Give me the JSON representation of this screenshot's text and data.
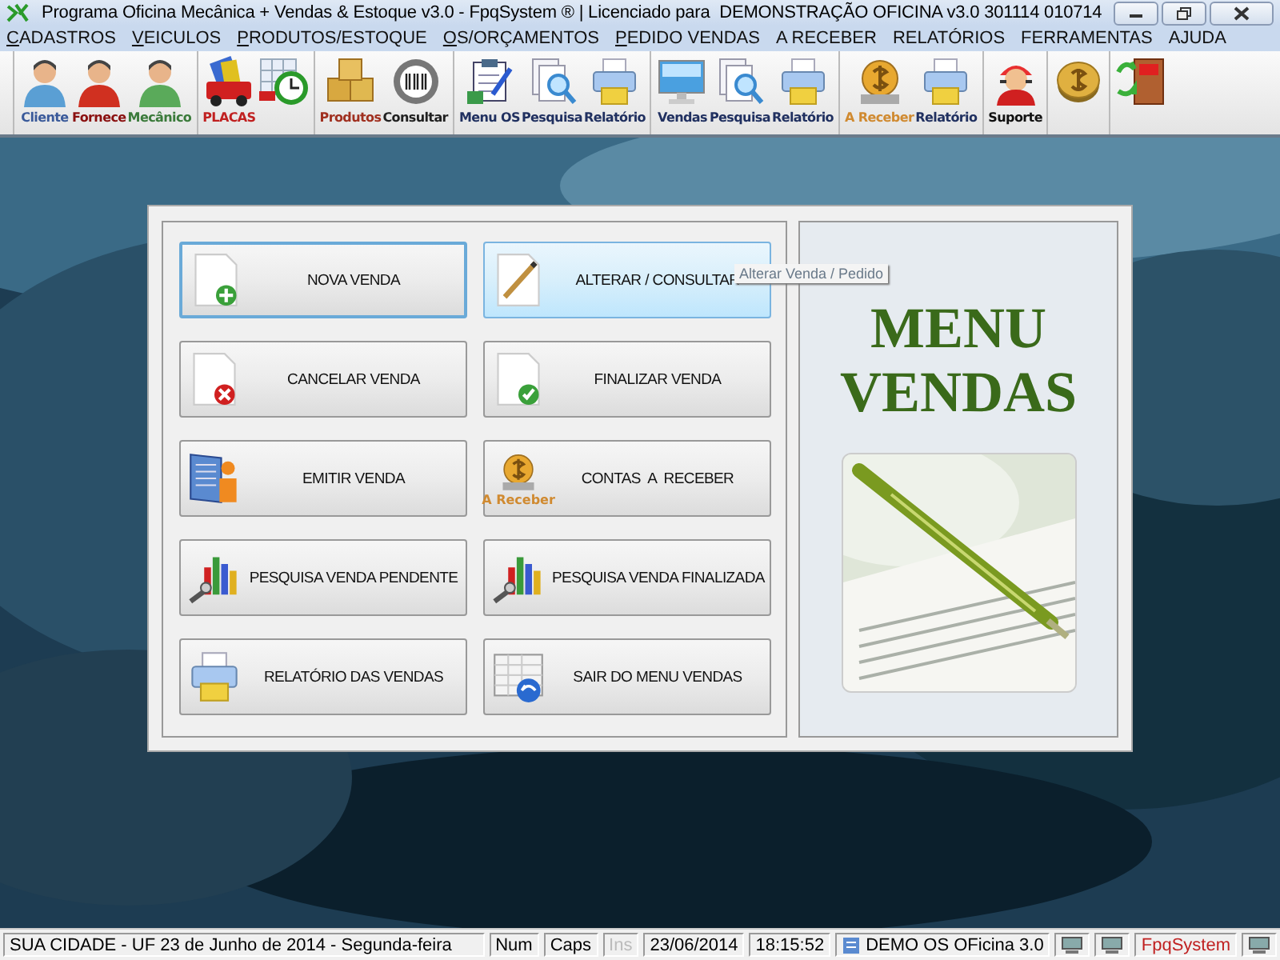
{
  "window": {
    "title": "Programa Oficina Mecânica + Vendas & Estoque v3.0 - FpqSystem ® | Licenciado para  DEMONSTRAÇÃO OFICINA v3.0 301114 010714"
  },
  "menu": [
    {
      "label": "CADASTROS",
      "access_key": true
    },
    {
      "label": "VEICULOS",
      "access_key": true
    },
    {
      "label": "PRODUTOS/ESTOQUE",
      "access_key": true
    },
    {
      "label": "OS/ORÇAMENTOS",
      "access_key": true
    },
    {
      "label": "PEDIDO VENDAS",
      "access_key": true
    },
    {
      "label": "A RECEBER",
      "access_key": false
    },
    {
      "label": "RELATÓRIOS",
      "access_key": false
    },
    {
      "label": "FERRAMENTAS",
      "access_key": false
    },
    {
      "label": "AJUDA",
      "access_key": false
    }
  ],
  "toolbar": [
    [
      {
        "kind": "person",
        "label": "Cliente",
        "color": "#3a5a9a"
      },
      {
        "kind": "person",
        "label": "Fornece",
        "color": "#8a1010"
      },
      {
        "kind": "person",
        "label": "Mecânico",
        "color": "#3a7a3a"
      }
    ],
    [
      {
        "kind": "truck",
        "label": "PLACAS",
        "color": "#c02020"
      },
      {
        "kind": "clock"
      }
    ],
    [
      {
        "kind": "boxes",
        "label": "Produtos",
        "color": "#a03020"
      },
      {
        "kind": "barcode",
        "label": "Consultar",
        "color": "#202020"
      }
    ],
    [
      {
        "kind": "clipboard",
        "label": "Menu OS",
        "color": "#203060"
      },
      {
        "kind": "search",
        "label": "Pesquisa",
        "color": "#203060"
      },
      {
        "kind": "printer",
        "label": "Relatório",
        "color": "#203060"
      }
    ],
    [
      {
        "kind": "monitor",
        "label": "Vendas",
        "color": "#203060"
      },
      {
        "kind": "search",
        "label": "Pesquisa",
        "color": "#203060"
      },
      {
        "kind": "printer",
        "label": "Relatório",
        "color": "#203060"
      }
    ],
    [
      {
        "kind": "money",
        "label": "A Receber",
        "color": "#d08a30"
      },
      {
        "kind": "printer",
        "label": "Relatório",
        "color": "#203060"
      }
    ],
    [
      {
        "kind": "support",
        "label": "Suporte",
        "color": "#101010"
      }
    ],
    [
      {
        "kind": "coin"
      }
    ],
    [
      {
        "kind": "exit"
      }
    ]
  ],
  "panel": {
    "heading": "MENU VENDAS",
    "buttons": [
      {
        "label": "NOVA VENDA",
        "focused": true,
        "hovered": false
      },
      {
        "label": "ALTERAR / CONSULTAR",
        "focused": false,
        "hovered": true
      },
      {
        "label": "CANCELAR VENDA",
        "focused": false,
        "hovered": false
      },
      {
        "label": "FINALIZAR VENDA",
        "focused": false,
        "hovered": false
      },
      {
        "label": "EMITIR VENDA",
        "focused": false,
        "hovered": false
      },
      {
        "label": "CONTAS  A  RECEBER",
        "icon_caption": "A Receber",
        "focused": false,
        "hovered": false
      },
      {
        "label": "PESQUISA VENDA PENDENTE",
        "focused": false,
        "hovered": false
      },
      {
        "label": "PESQUISA VENDA FINALIZADA",
        "focused": false,
        "hovered": false
      },
      {
        "label": "RELATÓRIO DAS VENDAS",
        "focused": false,
        "hovered": false
      },
      {
        "label": "SAIR DO MENU VENDAS",
        "focused": false,
        "hovered": false
      }
    ],
    "tooltip": "Alterar Venda / Pedido"
  },
  "status_bar": [
    {
      "kind": "text",
      "text": "SUA CIDADE - UF 23 de Junho de 2014 - Segunda-feira"
    },
    {
      "kind": "key",
      "text": "Num",
      "disabled": false
    },
    {
      "kind": "key",
      "text": "Caps",
      "disabled": false
    },
    {
      "kind": "key",
      "text": "Ins",
      "disabled": true
    },
    {
      "kind": "text",
      "text": "23/06/2014"
    },
    {
      "kind": "text",
      "text": "18:15:52"
    },
    {
      "kind": "app",
      "text": "DEMO OS OFicina 3.0"
    },
    {
      "kind": "icon"
    },
    {
      "kind": "icon"
    },
    {
      "kind": "brand",
      "text": "FpqSystem"
    },
    {
      "kind": "icon"
    }
  ]
}
